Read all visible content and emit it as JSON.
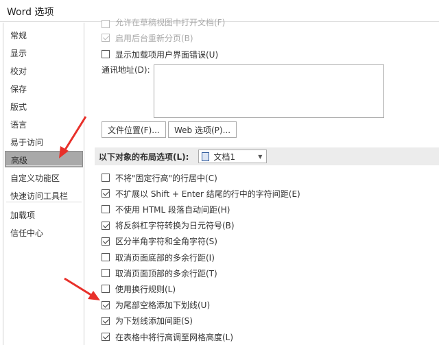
{
  "title": "Word 选项",
  "sidebar": {
    "items": [
      {
        "label": "常规"
      },
      {
        "label": "显示"
      },
      {
        "label": "校对"
      },
      {
        "label": "保存"
      },
      {
        "label": "版式"
      },
      {
        "label": "语言"
      },
      {
        "label": "易于访问"
      },
      {
        "label": "高级",
        "selected": true
      },
      {
        "label": "自定义功能区"
      },
      {
        "label": "快速访问工具栏"
      },
      {
        "label": "加载项"
      },
      {
        "label": "信任中心"
      }
    ]
  },
  "general": {
    "cut_item": "允许在草稿视图中打开文档(F)",
    "bg_repaginate": "启用后台重新分页(B)",
    "addin_errors": "显示加载项用户界面错误(U)",
    "mailing_label": "通讯地址(D):",
    "mailing_value": "",
    "file_locations": "文件位置(F)...",
    "web_options": "Web 选项(P)..."
  },
  "layout": {
    "label": "以下对象的布局选项(L):",
    "document": "文档1",
    "options": [
      {
        "label": "不将\"固定行高\"的行居中(C)",
        "checked": false
      },
      {
        "label": "不扩展以 Shift + Enter 结尾的行中的字符间距(E)",
        "checked": true
      },
      {
        "label": "不使用 HTML 段落自动间距(H)",
        "checked": false
      },
      {
        "label": "将反斜杠字符转换为日元符号(B)",
        "checked": true
      },
      {
        "label": "区分半角字符和全角字符(S)",
        "checked": true
      },
      {
        "label": "取消页面底部的多余行距(I)",
        "checked": false
      },
      {
        "label": "取消页面顶部的多余行距(T)",
        "checked": false
      },
      {
        "label": "使用换行规则(L)",
        "checked": false
      },
      {
        "label": "为尾部空格添加下划线(U)",
        "checked": true
      },
      {
        "label": "为下划线添加间距(S)",
        "checked": true
      },
      {
        "label": "在表格中将行高调至网格高度(L)",
        "checked": true
      }
    ]
  },
  "colors": {
    "arrow": "#e8302a",
    "selected": "#a9a9a9"
  }
}
